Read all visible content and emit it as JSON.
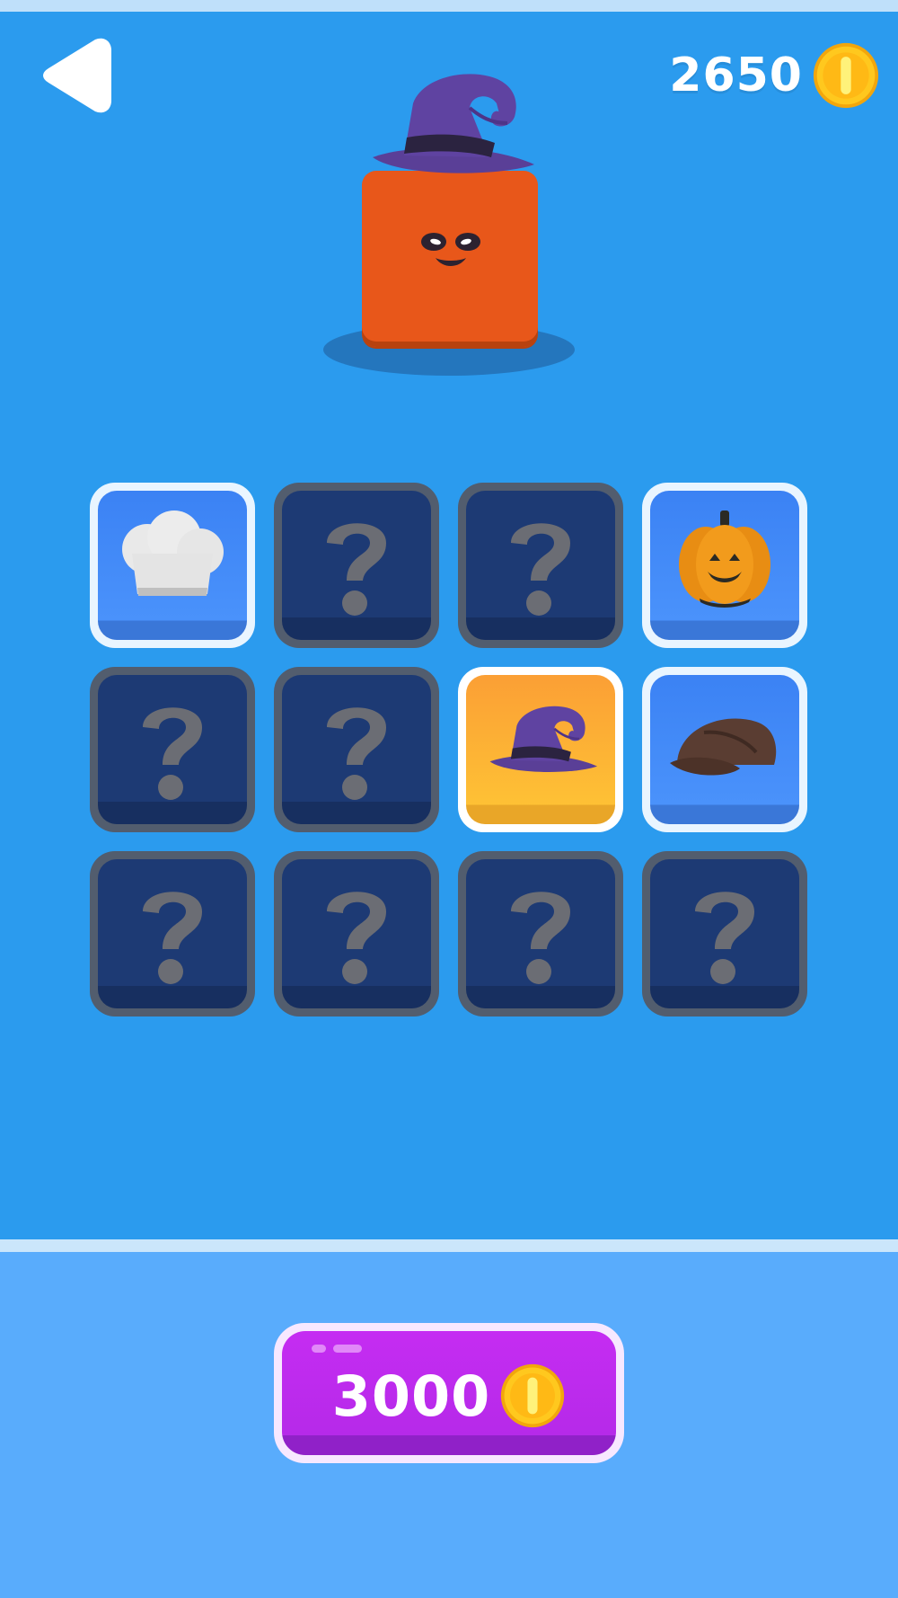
{
  "header": {
    "coins": "2650",
    "back_icon": "back-arrow-icon",
    "coin_icon": "gold-coin-icon"
  },
  "preview": {
    "character": "orange-cube-character",
    "equipped_hat": "witch-hat"
  },
  "shop": {
    "slots": [
      {
        "item": "chef-hat",
        "state": "owned"
      },
      {
        "item": "unknown",
        "state": "locked"
      },
      {
        "item": "unknown",
        "state": "locked"
      },
      {
        "item": "pumpkin",
        "state": "owned"
      },
      {
        "item": "unknown",
        "state": "locked"
      },
      {
        "item": "unknown",
        "state": "locked"
      },
      {
        "item": "witch-hat",
        "state": "selected"
      },
      {
        "item": "flat-cap",
        "state": "owned"
      },
      {
        "item": "unknown",
        "state": "locked"
      },
      {
        "item": "unknown",
        "state": "locked"
      },
      {
        "item": "unknown",
        "state": "locked"
      },
      {
        "item": "unknown",
        "state": "locked"
      }
    ]
  },
  "buy_button": {
    "price": "3000",
    "icon": "gold-coin-icon"
  },
  "colors": {
    "background": "#2b9bee",
    "bottom_panel": "#59acfc",
    "locked_slot": "#1d3a74",
    "owned_slot": "#4a92fb",
    "selected_slot": "#fec135",
    "buy_button": "#b62ae9",
    "coin": "#ffc81e"
  }
}
